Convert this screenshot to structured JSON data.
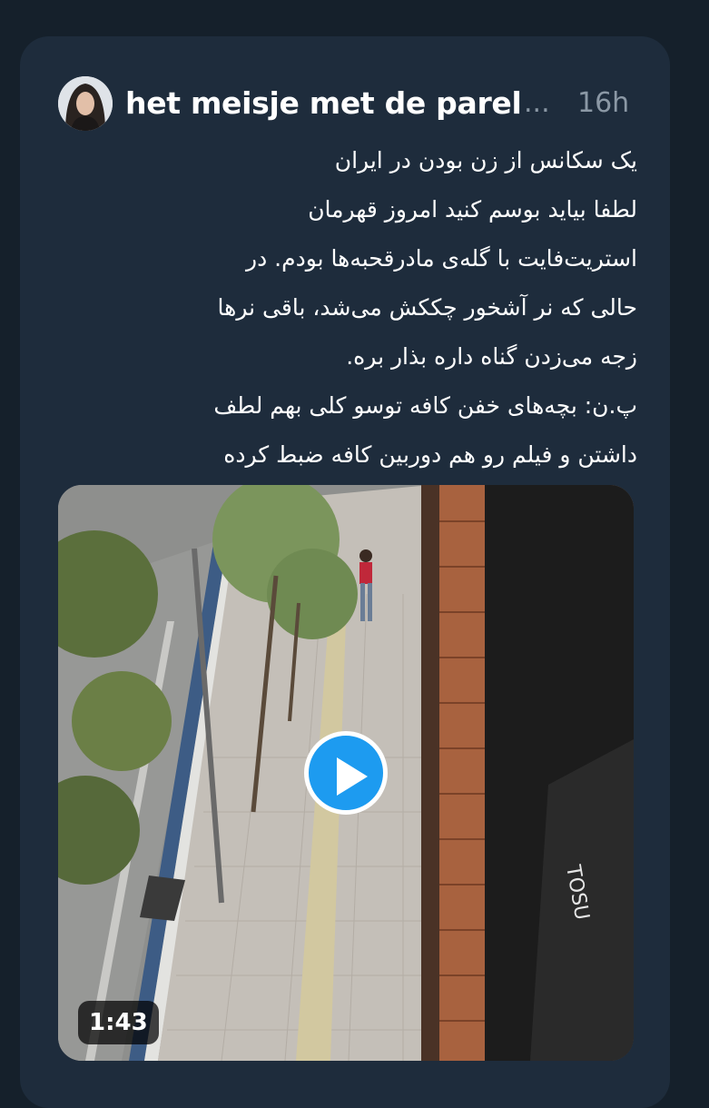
{
  "tweet": {
    "author_name": "het meisje met de parel",
    "ellipsis": "...",
    "time_ago": "16h",
    "text_lines": [
      "یک سکانس از زن بودن در ایران",
      "لطفا بیاید بوسم کنید امروز قهرمان",
      "استریت‌فایت با گله‌ی مادرقحبه‌ها بودم. در",
      "حالی که نر آشخور چککش می‌شد، باقی نرها",
      "زجه می‌زدن گناه داره بذار بره.",
      "پ.ن: بچه‌های خفن کافه توسو کلی بهم لطف",
      "داشتن و فیلم رو هم دوربین کافه ضبط کرده"
    ]
  },
  "media": {
    "duration": "1:43",
    "play_icon": "play-icon",
    "shop_sign_text": "TOSU"
  },
  "colors": {
    "background": "#15202b",
    "card": "#1e2c3c",
    "accent": "#1d9bf0",
    "muted": "#8b98a5"
  }
}
